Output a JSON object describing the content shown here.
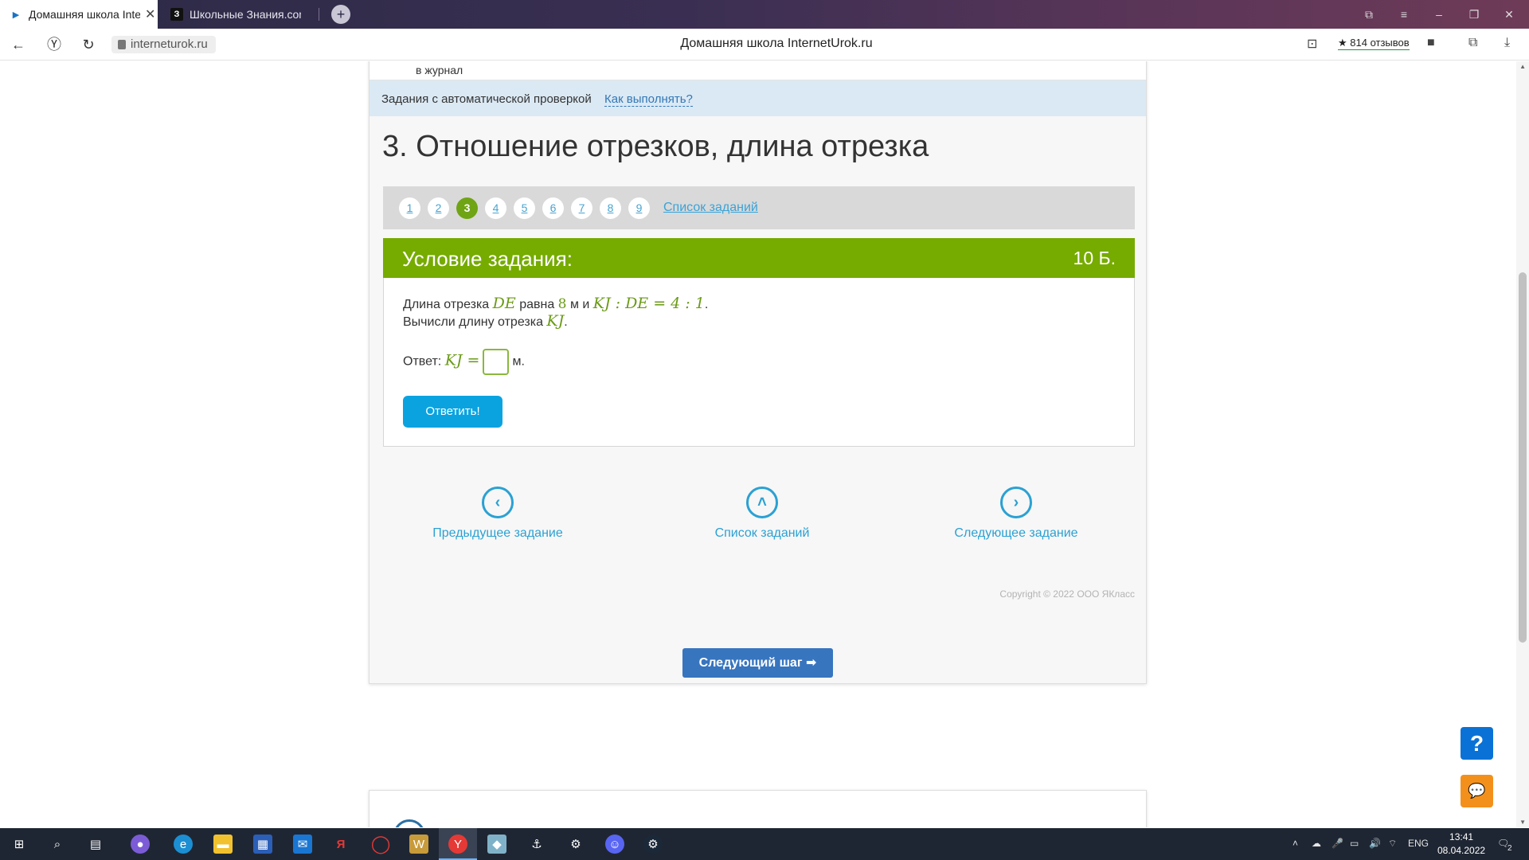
{
  "browser": {
    "tabs": [
      {
        "title": "Домашняя школа Inter",
        "active": true
      },
      {
        "title": "Школьные Знания.com - F",
        "active": false
      }
    ],
    "new_tab_glyph": "+",
    "url": "interneturok.ru",
    "page_title": "Домашняя школа InternetUrok.ru",
    "reviews": "★ 814 отзывов",
    "window_controls": [
      "⧉",
      "≡",
      "–",
      "❐",
      "✕"
    ]
  },
  "page": {
    "journal_text": "в журнал",
    "autocheck_label": "Задания с автоматической проверкой",
    "autocheck_link": "Как выполнять?",
    "heading": "3. Отношение отрезков, длина отрезка",
    "pager": {
      "pages": [
        "1",
        "2",
        "3",
        "4",
        "5",
        "6",
        "7",
        "8",
        "9"
      ],
      "current": "3",
      "tasks_link": "Список заданий"
    },
    "condition": {
      "title": "Условие задания:",
      "points": "10 Б.",
      "line1": {
        "t1": "Длина отрезка ",
        "m1": "DE",
        "t2": " равна ",
        "n1": "8",
        "t3": " м и ",
        "m2": "KJ : DE = 4 : 1",
        "t4": "."
      },
      "line2": {
        "t1": "Вычисли длину отрезка ",
        "m1": "KJ",
        "t2": "."
      },
      "answer": {
        "label": "Ответ: ",
        "math": "KJ =",
        "value": "",
        "unit": "м."
      },
      "submit": "Ответить!"
    },
    "nav": {
      "prev": "Предыдущее задание",
      "list": "Список заданий",
      "next": "Следующее задание"
    },
    "copyright": "Copyright © 2022 ООО ЯКласс",
    "next_step": "Следующий шаг ➡",
    "help_glyph": "?"
  },
  "taskbar": {
    "language": "ENG",
    "time": "13:41",
    "date": "08.04.2022",
    "notifications": "2"
  }
}
